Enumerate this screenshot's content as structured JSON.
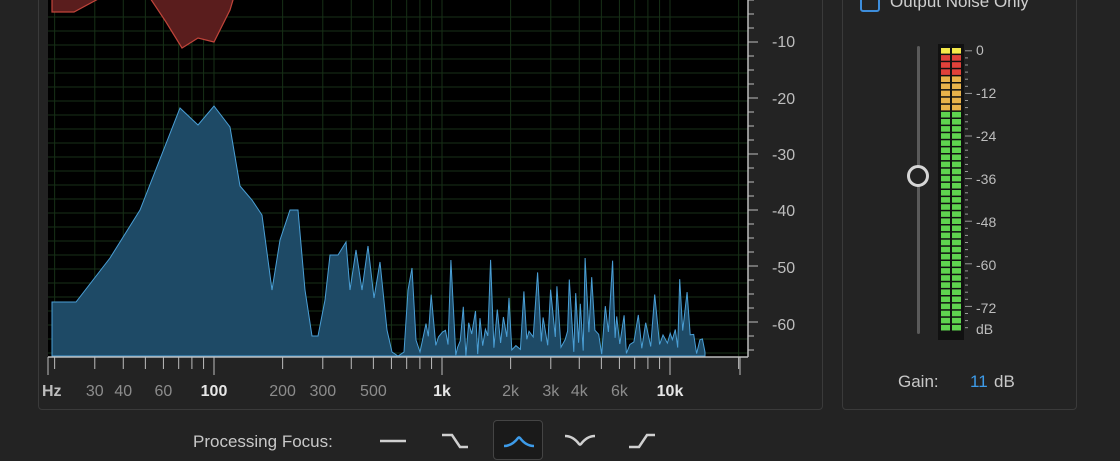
{
  "output_noise": {
    "label": "Output Noise Only",
    "checked": false
  },
  "graph": {
    "db_ticks": [
      "-10",
      "-20",
      "-30",
      "-40",
      "-50",
      "-60"
    ],
    "hz_unit": "Hz",
    "hz_ticks": [
      {
        "label": "30",
        "hz": 30,
        "major": false
      },
      {
        "label": "40",
        "hz": 40,
        "major": false
      },
      {
        "label": "60",
        "hz": 60,
        "major": false
      },
      {
        "label": "100",
        "hz": 100,
        "major": true
      },
      {
        "label": "200",
        "hz": 200,
        "major": false
      },
      {
        "label": "300",
        "hz": 300,
        "major": false
      },
      {
        "label": "500",
        "hz": 500,
        "major": false
      },
      {
        "label": "1k",
        "hz": 1000,
        "major": true
      },
      {
        "label": "2k",
        "hz": 2000,
        "major": false
      },
      {
        "label": "3k",
        "hz": 3000,
        "major": false
      },
      {
        "label": "4k",
        "hz": 4000,
        "major": false
      },
      {
        "label": "6k",
        "hz": 6000,
        "major": false
      },
      {
        "label": "10k",
        "hz": 10000,
        "major": true
      }
    ],
    "colors": {
      "noise_fill": "#1e4a66",
      "noise_stroke": "#4a9fd6",
      "profile_fill": "#5a1d1d",
      "profile_stroke": "#c0443a",
      "grid": "#173017"
    }
  },
  "meter": {
    "scale_labels": [
      "0",
      "-12",
      "-24",
      "-36",
      "-48",
      "-60",
      "-72",
      "dB"
    ],
    "colors": {
      "green": "#5fd34f",
      "amber": "#e8b24a",
      "red": "#e0413a",
      "yellow": "#f4e84a"
    }
  },
  "gain": {
    "label": "Gain:",
    "value": "11",
    "unit": "dB"
  },
  "processing_focus": {
    "label": "Processing Focus:",
    "buttons": [
      {
        "name": "focus-all-frequencies-button",
        "shape": "flat",
        "active": false
      },
      {
        "name": "focus-low-frequencies-button",
        "shape": "low",
        "active": false
      },
      {
        "name": "focus-mid-frequencies-button",
        "shape": "mid",
        "active": true
      },
      {
        "name": "focus-high-low-frequencies-button",
        "shape": "notch",
        "active": false
      },
      {
        "name": "focus-high-frequencies-button",
        "shape": "high",
        "active": false
      }
    ]
  }
}
